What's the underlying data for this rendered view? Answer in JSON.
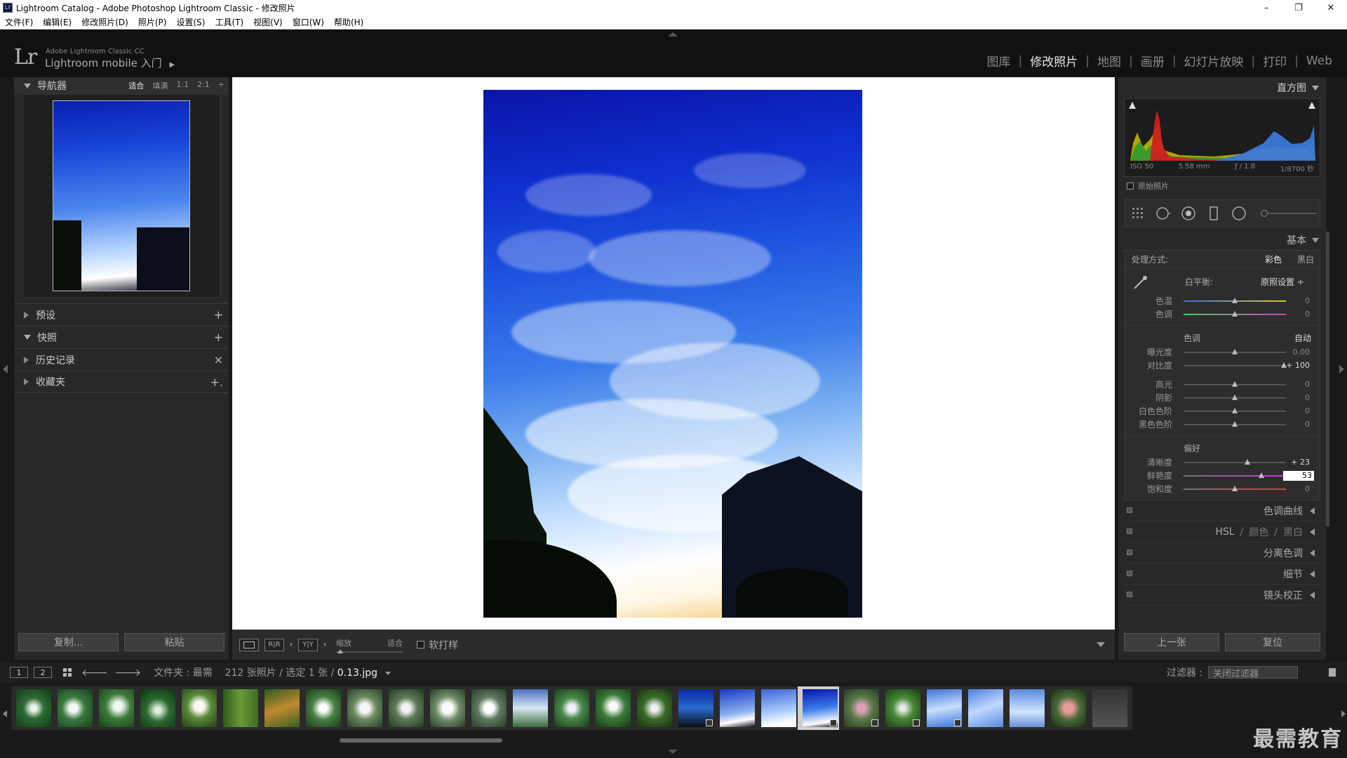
{
  "window": {
    "title": "Lightroom Catalog - Adobe Photoshop Lightroom Classic - 修改照片",
    "icon_label": "Lr",
    "controls": [
      "–",
      "❐",
      "✕"
    ]
  },
  "menu": [
    "文件(F)",
    "编辑(E)",
    "修改照片(D)",
    "照片(P)",
    "设置(S)",
    "工具(T)",
    "视图(V)",
    "窗口(W)",
    "帮助(H)"
  ],
  "identity": {
    "logo": "Lr",
    "line1": "Adobe Lightroom Classic CC",
    "line2": "Lightroom mobile 入门",
    "line2_arrow": "▶"
  },
  "modules": [
    {
      "label": "图库",
      "active": false
    },
    {
      "label": "修改照片",
      "active": true
    },
    {
      "label": "地图",
      "active": false
    },
    {
      "label": "画册",
      "active": false
    },
    {
      "label": "幻灯片放映",
      "active": false
    },
    {
      "label": "打印",
      "active": false
    },
    {
      "label": "Web",
      "active": false
    }
  ],
  "navigator": {
    "title": "导航器",
    "zoom": [
      "适合",
      "填满",
      "1:1",
      "2:1"
    ],
    "zoom_active": "适合",
    "zoom_more": "÷"
  },
  "left_sections": [
    {
      "label": "预设",
      "action": "+"
    },
    {
      "label": "快照",
      "action": "+",
      "expanded": true
    },
    {
      "label": "历史记录",
      "action": "×"
    },
    {
      "label": "收藏夹",
      "action": "+."
    }
  ],
  "left_buttons": {
    "copy": "复制...",
    "paste": "粘贴"
  },
  "toolbar": {
    "view_icons": [
      "▭",
      "R|R",
      "Y|Y"
    ],
    "zoom_label": "缩放",
    "zoom_value": "适合",
    "softproof": "软打样"
  },
  "histogram": {
    "title": "直方图",
    "iso": "ISO 50",
    "focal": "5.58 mm",
    "aperture": "ƒ / 1.8",
    "shutter": "1/8700 秒",
    "original": "原始照片"
  },
  "basic": {
    "title": "基本",
    "treatment_label": "处理方式:",
    "treatment_options": [
      "彩色",
      "黑白"
    ],
    "treatment_active": "彩色",
    "wb_label": "白平衡:",
    "wb_value": "原照设置 ÷",
    "wb_sliders": [
      {
        "label": "色温",
        "value": "0",
        "pos": 0.5,
        "track": "linear-gradient(90deg,#3a6fd8,#d8c83a)"
      },
      {
        "label": "色调",
        "value": "0",
        "pos": 0.5,
        "track": "linear-gradient(90deg,#3ad85a,#d83ac8)"
      }
    ],
    "tone_label": "色调",
    "auto_label": "自动",
    "tone_sliders": [
      {
        "label": "曝光度",
        "value": "0.00",
        "pos": 0.5
      },
      {
        "label": "对比度",
        "value": "+ 100",
        "pos": 0.98,
        "strong": true
      }
    ],
    "tone_sliders2": [
      {
        "label": "高光",
        "value": "0",
        "pos": 0.5
      },
      {
        "label": "阴影",
        "value": "0",
        "pos": 0.5
      },
      {
        "label": "白色色阶",
        "value": "0",
        "pos": 0.5
      },
      {
        "label": "黑色色阶",
        "value": "0",
        "pos": 0.5
      }
    ],
    "presence_label": "偏好",
    "presence_sliders": [
      {
        "label": "清晰度",
        "value": "+ 23",
        "pos": 0.62,
        "strong": true
      },
      {
        "label": "鲜艳度",
        "value": "53",
        "pos": 0.76,
        "edit": true,
        "track": "linear-gradient(90deg,#777,#c83ad8)"
      },
      {
        "label": "饱和度",
        "value": "0",
        "pos": 0.5,
        "track": "linear-gradient(90deg,#777,#d83a3a)"
      }
    ]
  },
  "right_sections": [
    {
      "label": "色调曲线"
    },
    {
      "label": "HSL",
      "extra": [
        "颜色",
        "黑白"
      ]
    },
    {
      "label": "分离色调"
    },
    {
      "label": "细节"
    },
    {
      "label": "镜头校正"
    }
  ],
  "right_buttons": {
    "prev": "上一张",
    "reset": "复位"
  },
  "filmbar": {
    "page1": "1",
    "page2": "2",
    "nav_back": "🡐",
    "nav_fwd": "🡒",
    "folder_prefix": "文件夹 : 最需",
    "count": "212 张照片 / 选定 1 张 /",
    "filename": "0.13.jpg",
    "filter_label": "过滤器 :",
    "filter_value": "关闭过滤器"
  },
  "filmstrip_thumbs": [
    {
      "bg": "radial-gradient(circle at 50% 50%,#e8f2e8 12%,#2e6b35 40%,#143a1a 100%)"
    },
    {
      "bg": "radial-gradient(circle at 45% 50%,#f4f8f4 15%,#3a7b40 42%,#163d1c 100%)"
    },
    {
      "bg": "radial-gradient(circle at 55% 45%,#f2f6f0 15%,#3c7c3c 44%,#183e18 100%)"
    },
    {
      "bg": "radial-gradient(circle at 50% 55%,#dfeee0 10%,#2c6a30 42%,#0f3312 100%)"
    },
    {
      "bg": "radial-gradient(circle at 50% 45%,#fafaf2 18%,#5a8a3a 44%,#233e16 100%)"
    },
    {
      "bg": "linear-gradient(90deg,#2e5a1a,#6a9a3a,#3e6a22)"
    },
    {
      "bg": "linear-gradient(160deg,#2e5a20,#c08a30 50%,#3a6022)"
    },
    {
      "bg": "radial-gradient(circle at 50% 50%,#fff 15%,#4a8046 44%,#1a3a18 100%)"
    },
    {
      "bg": "radial-gradient(circle at 50% 50%,#f6f6f6 18%,#6c8a60 44%,#28402a 100%)"
    },
    {
      "bg": "radial-gradient(circle at 50% 50%,#f2f2f2 16%,#607a58 42%,#223a20 100%)"
    },
    {
      "bg": "radial-gradient(circle at 50% 50%,#fafafa 20%,#708c68 46%,#2a3e26 100%)"
    },
    {
      "bg": "radial-gradient(circle at 50% 50%,#ffffff 18%,#607860 44%,#2a3a2a 100%)"
    },
    {
      "bg": "linear-gradient(180deg,#4a70c0,#d8e8f0 50%,#3a6a40)"
    },
    {
      "bg": "radial-gradient(circle at 50% 50%,#f0f0ff 14%,#4a8a4a 40%,#1a3a1a 100%)"
    },
    {
      "bg": "radial-gradient(circle at 50% 45%,#f8f8f8 14%,#3a7a3a 44%,#163816 100%)"
    },
    {
      "bg": "radial-gradient(circle at 50% 50%,#f2f2f2 12%,#3a6a2a 44%,#1a3010 100%)"
    },
    {
      "bg": "linear-gradient(180deg,#0a2aa0,#2a6ad0 50%,#0a0a14)",
      "badge": true
    },
    {
      "bg": "linear-gradient(170deg,#1a3ac8,#8ab0ee 60%,#ffffff 80%,#0a0a1a)"
    },
    {
      "bg": "linear-gradient(170deg,#3a64d8,#b0d0ff 60%,#ffffff 85%)"
    },
    {
      "bg": "linear-gradient(172deg,#0a14a6,#3b7cea 50%,#ffffff 85%,#0a0a1a)",
      "selected": true,
      "badge": true
    },
    {
      "bg": "radial-gradient(circle at 50% 50%,#e0a0b8 14%,#5a7a4a 44%,#2a3a20 100%)",
      "badge": true
    },
    {
      "bg": "radial-gradient(circle at 50% 50%,#eaeaea 10%,#4a8a3a 40%,#1a3a12 100%)",
      "badge": true
    },
    {
      "bg": "linear-gradient(170deg,#3a70d8,#c8e0ff 50%,#3a70d8)",
      "badge": true
    },
    {
      "bg": "linear-gradient(160deg,#4a80e0,#c0d8ff 50%,#5a8ae0)"
    },
    {
      "bg": "linear-gradient(180deg,#5a8ae0,#d0e4ff 60%,#6a90d8)"
    },
    {
      "bg": "radial-gradient(circle at 50% 50%,#e89a98 18%,#4a6a3a 46%,#1a2a14 100%)"
    },
    {
      "bg": "linear-gradient(180deg,#333,#555)"
    }
  ],
  "watermark": "最需教育"
}
